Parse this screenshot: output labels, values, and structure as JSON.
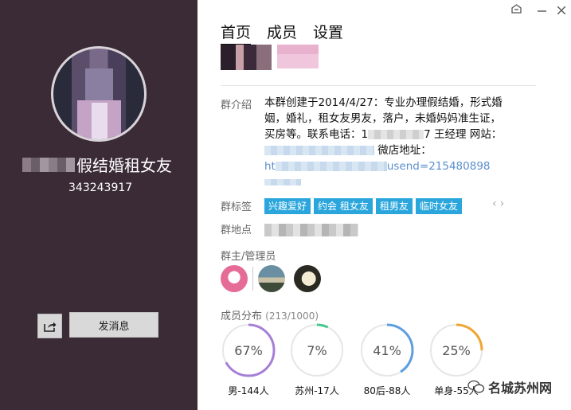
{
  "left": {
    "group_name": "假结婚租女友",
    "group_id": "343243917",
    "send_button": "发消息"
  },
  "tabs": [
    "首页",
    "成员",
    "设置"
  ],
  "labels": {
    "intro": "群介绍",
    "tags": "群标签",
    "location": "群地点",
    "admins": "群主/管理员",
    "distribution": "成员分布",
    "distribution_count": "(213/1000)"
  },
  "intro": {
    "line1": "本群创建于2014/4/27：专业办理假结婚，形式婚",
    "line2": "姻，婚礼，租女友男友，落户，未婚妈妈准生证，",
    "line3a": "买房等。联系电话：1",
    "line3b": "7 王经理 网站：",
    "line4": "微店地址：",
    "line5a": "ht",
    "line5b": "usend=215480898"
  },
  "tags": [
    "兴趣爱好",
    "约会 租女友",
    "租男友",
    "临时女友"
  ],
  "distribution": [
    {
      "value": "67%",
      "fraction": 0.67,
      "caption": "男-144人",
      "color": "#a57fd6"
    },
    {
      "value": "7%",
      "fraction": 0.07,
      "caption": "苏州-17人",
      "color": "#3fc98a"
    },
    {
      "value": "41%",
      "fraction": 0.41,
      "caption": "80后-88人",
      "color": "#5c9ee0"
    },
    {
      "value": "25%",
      "fraction": 0.25,
      "caption": "单身-55人",
      "color": "#f1a531"
    }
  ],
  "watermark": "名城苏州网",
  "icons": {
    "share": "share-icon",
    "skin": "skin-icon",
    "close": "close-icon"
  }
}
